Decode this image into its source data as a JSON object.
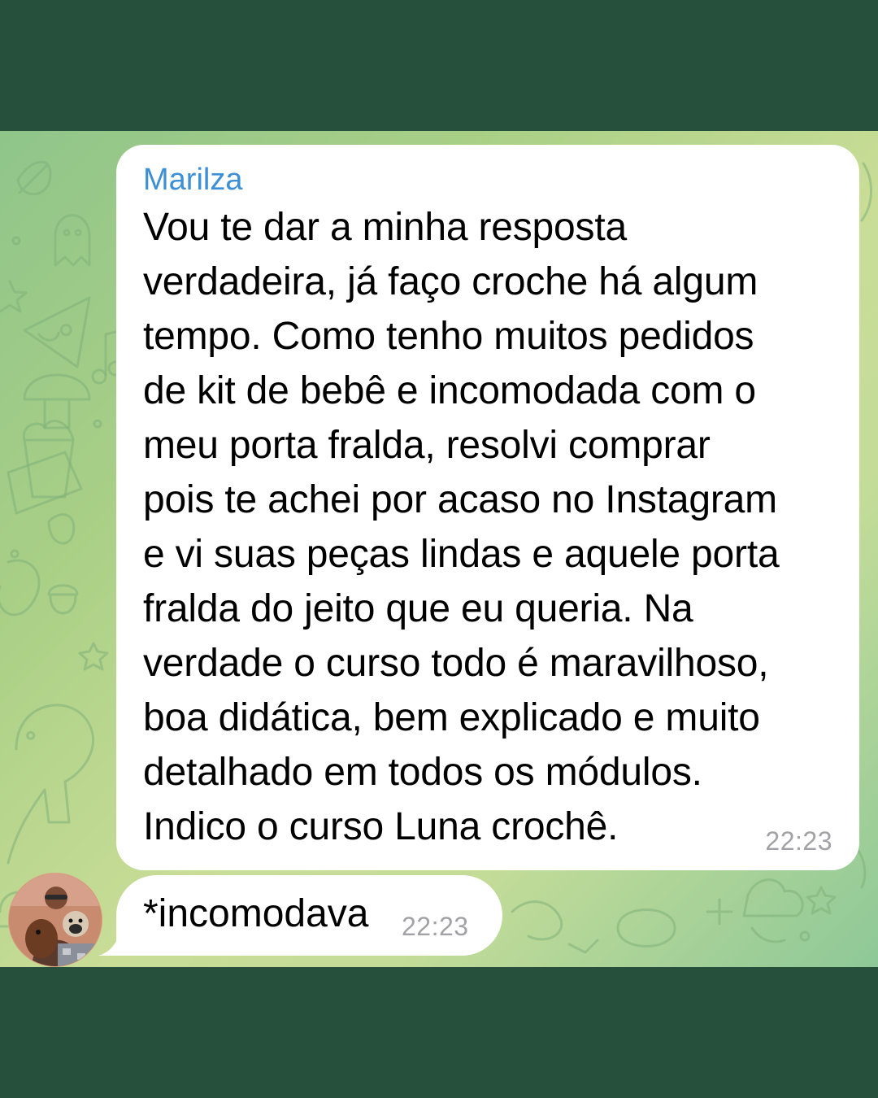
{
  "colors": {
    "frame_background": "#27503c",
    "bubble_background": "#ffffff",
    "sender_name": "#3d8fd6",
    "timestamp": "#a2a2a6"
  },
  "messages": [
    {
      "sender": "Marilza",
      "text": "Vou te dar a minha resposta\nverdadeira, já faço croche há algum\ntempo. Como tenho muitos pedidos\nde kit de bebê e incomodada com o\nmeu porta fralda, resolvi comprar\npois te achei por acaso no Instagram\ne vi suas peças lindas e aquele porta\nfralda do jeito que eu queria. Na\nverdade o curso todo é maravilhoso,\nboa didática, bem explicado e muito\ndetalhado em todos os módulos.\nIndico o curso Luna crochê.",
      "time": "22:23"
    },
    {
      "text": "*incomodava",
      "time": "22:23"
    }
  ],
  "icons": {
    "avatar": "sender-avatar-photo",
    "wallpaper": "doodle-pattern"
  }
}
